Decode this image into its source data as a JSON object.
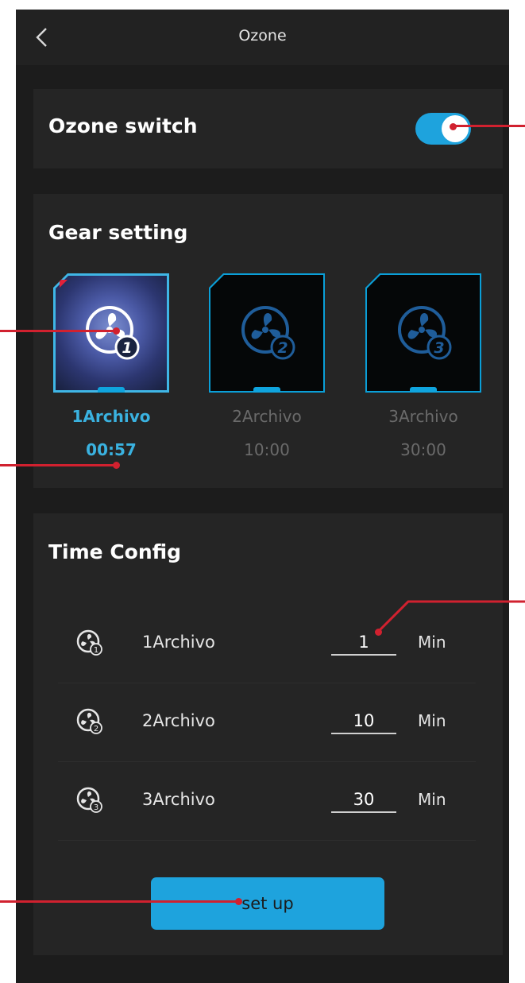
{
  "header": {
    "title": "Ozone",
    "back_icon": "chevron-left-icon"
  },
  "ozone_switch": {
    "label": "Ozone switch",
    "on": true,
    "accent": "#1ea3dd"
  },
  "gear_setting": {
    "title": "Gear setting",
    "items": [
      {
        "name": "1Archivo",
        "time": "00:57",
        "active": true
      },
      {
        "name": "2Archivo",
        "time": "10:00",
        "active": false
      },
      {
        "name": "3Archivo",
        "time": "30:00",
        "active": false
      }
    ]
  },
  "time_config": {
    "title": "Time Config",
    "rows": [
      {
        "name": "1Archivo",
        "value": "1",
        "unit": "Min"
      },
      {
        "name": "2Archivo",
        "value": "10",
        "unit": "Min"
      },
      {
        "name": "3Archivo",
        "value": "30",
        "unit": "Min"
      }
    ],
    "button_label": "set up"
  },
  "colors": {
    "accent": "#1ea3dd",
    "annotation": "#d1212f",
    "background": "#1c1c1c",
    "card": "#252525"
  }
}
